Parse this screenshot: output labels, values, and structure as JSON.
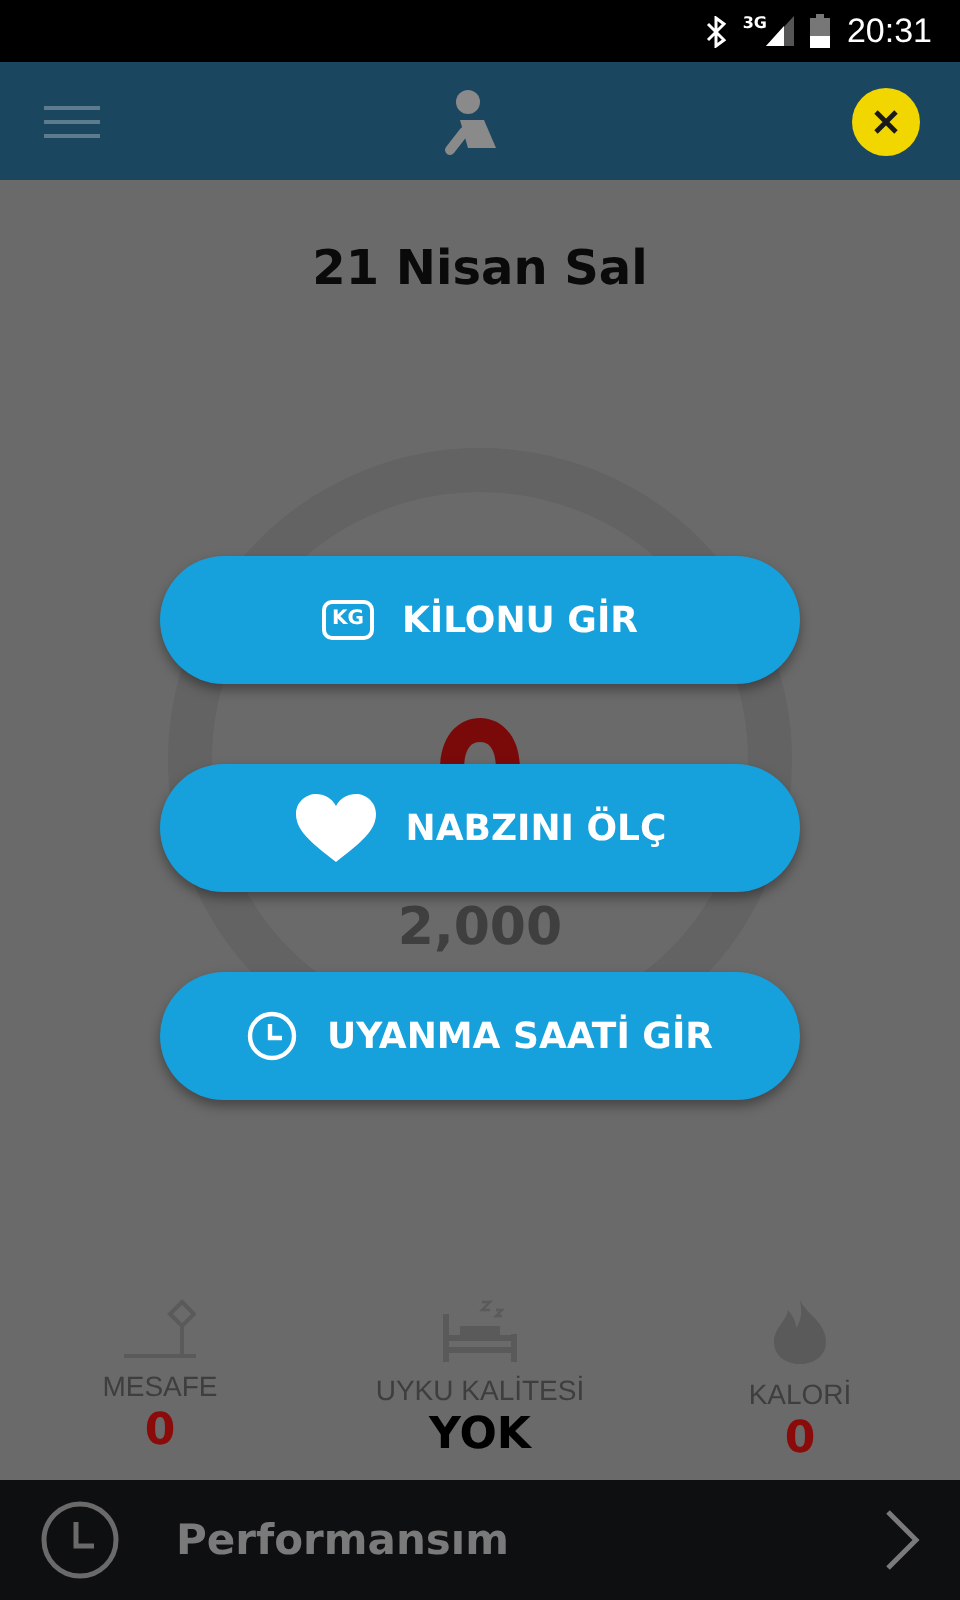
{
  "status_bar": {
    "network": "3G",
    "time": "20:31"
  },
  "date": "21 Nisan Sal",
  "gauge": {
    "goal": "2,000"
  },
  "actions": [
    {
      "kind": "weight",
      "icon_text": "KG",
      "label": "KİLONU GİR"
    },
    {
      "kind": "heart",
      "label": "NABZINI ÖLÇ"
    },
    {
      "kind": "clock",
      "label": "UYANMA SAATİ GİR"
    }
  ],
  "stats": [
    {
      "kind": "distance",
      "label": "MESAFE",
      "value": "0",
      "color": "#8b0a0a"
    },
    {
      "kind": "sleep",
      "label": "UYKU KALİTESİ",
      "value": "YOK",
      "color": "#000000"
    },
    {
      "kind": "calorie",
      "label": "KALORİ",
      "value": "0",
      "color": "#8b0a0a"
    }
  ],
  "bottom_bar": {
    "label": "Performansım"
  }
}
